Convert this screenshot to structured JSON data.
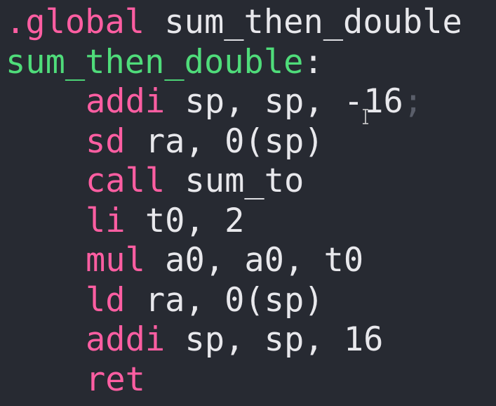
{
  "editor": {
    "lines": [
      {
        "keyword": ".global",
        "rest": " sum_then_double"
      },
      {
        "keyword": "sum_then_double",
        "rest": ":"
      },
      {
        "keyword": "addi",
        "rest": " sp, sp, -16",
        "trail": ";"
      },
      {
        "keyword": "sd",
        "rest": " ra, 0(sp)"
      },
      {
        "keyword": "call",
        "rest": " sum_to"
      },
      {
        "keyword": "li",
        "rest": " t0, 2"
      },
      {
        "keyword": "mul",
        "rest": " a0, a0, t0"
      },
      {
        "keyword": "ld",
        "rest": " ra, 0(sp)"
      },
      {
        "keyword": "addi",
        "rest": " sp, sp, 16"
      },
      {
        "keyword": "ret",
        "rest": ""
      }
    ]
  },
  "colors": {
    "background": "#272a32",
    "directive": "#ff5ea2",
    "label": "#4fdc7a",
    "instruction": "#ff5ea2",
    "text": "#e8e8ec",
    "dim": "#5a5e6a"
  },
  "icons": {
    "cursor": "text-cursor-icon"
  }
}
